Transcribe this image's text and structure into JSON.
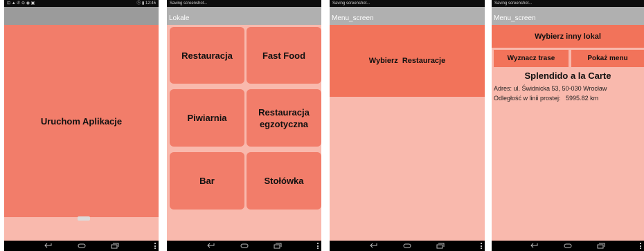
{
  "status_bar": {
    "screen1_left": "⊡ ▲ ✆ ⊖ ◉ ▣",
    "screen1_right": "ⓝ ▮ 12:45",
    "saving_text": "Saving screenshot..."
  },
  "screen1": {
    "start_button": "Uruchom Aplikacje"
  },
  "screen2": {
    "title": "Lokale",
    "categories": [
      "Restauracja",
      "Fast Food",
      "Piwiarnia",
      "Restauracja egzotyczna",
      "Bar",
      "Stołówka"
    ]
  },
  "screen3": {
    "title": "Menu_screen",
    "choose_button": "Wybierz  Restauracje"
  },
  "screen4": {
    "title": "Menu_screen",
    "choose_other_button": "Wybierz inny lokal",
    "route_button": "Wyznacz trase",
    "menu_button": "Pokaż menu",
    "restaurant_name": "Splendido a la Carte",
    "address": "Adres: ul. Świdnicka 53, 50-030 Wrocław",
    "distance": "Odległość w linii prostej:   5995.82 km"
  },
  "colors": {
    "accent": "#f2735a",
    "tile": "#f27d6a",
    "background": "#f9b9ad",
    "actionbar": "#9b9b9b"
  },
  "icons": [
    "back-icon",
    "home-icon",
    "recent-apps-icon",
    "overflow-menu-icon"
  ]
}
